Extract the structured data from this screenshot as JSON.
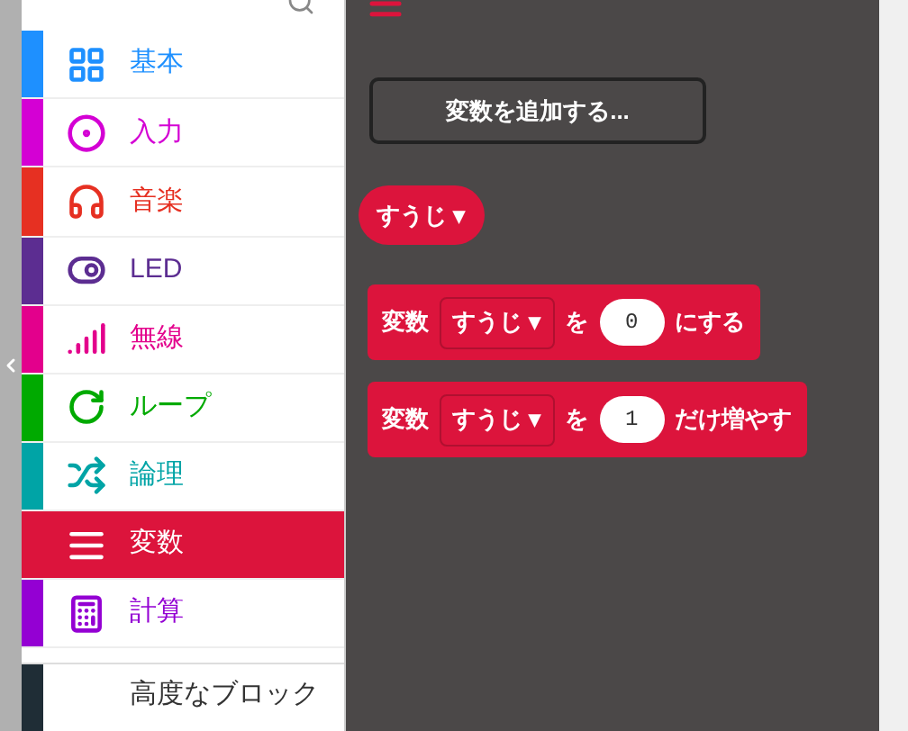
{
  "categories": [
    {
      "label": "基本",
      "kind": "grid",
      "color": "#1e90ff",
      "selected": false
    },
    {
      "label": "入力",
      "kind": "target",
      "color": "#d400d4",
      "selected": false
    },
    {
      "label": "音楽",
      "kind": "headphones",
      "color": "#e63022",
      "selected": false
    },
    {
      "label": "LED",
      "kind": "toggle",
      "color": "#5c2d91",
      "selected": false
    },
    {
      "label": "無線",
      "kind": "signal",
      "color": "#e3008c",
      "selected": false
    },
    {
      "label": "ループ",
      "kind": "loop",
      "color": "#00aa00",
      "selected": false
    },
    {
      "label": "論理",
      "kind": "shuffle",
      "color": "#00a4a6",
      "selected": false
    },
    {
      "label": "変数",
      "kind": "lines",
      "color": "#dc143c",
      "selected": true
    },
    {
      "label": "計算",
      "kind": "calculator",
      "color": "#9400d3",
      "selected": false
    }
  ],
  "advanced": {
    "label": "高度なブロック",
    "color": "#1f2d36"
  },
  "flyout": {
    "add_button": "変数を追加する...",
    "variable": "すうじ ▾",
    "blocks": [
      {
        "parts": [
          {
            "kind": "text",
            "text": "変数"
          },
          {
            "kind": "dropdown",
            "text": "すうじ ▾"
          },
          {
            "kind": "text",
            "text": "を"
          },
          {
            "kind": "number",
            "text": "0"
          },
          {
            "kind": "text",
            "text": "にする"
          }
        ]
      },
      {
        "parts": [
          {
            "kind": "text",
            "text": "変数"
          },
          {
            "kind": "dropdown",
            "text": "すうじ ▾"
          },
          {
            "kind": "text",
            "text": "を"
          },
          {
            "kind": "number",
            "text": "1"
          },
          {
            "kind": "text",
            "text": "だけ増やす"
          }
        ]
      }
    ]
  }
}
